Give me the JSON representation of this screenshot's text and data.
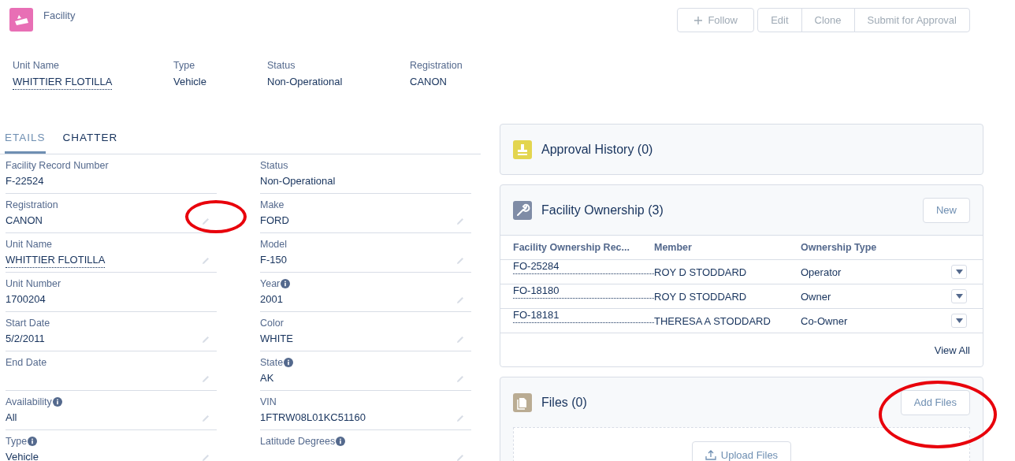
{
  "header": {
    "object_type": "Facility",
    "actions": [
      "Follow",
      "Edit",
      "Clone",
      "Submit for Approval"
    ],
    "highlights": [
      {
        "label": "Unit Name",
        "value": "WHITTIER FLOTILLA",
        "link": true
      },
      {
        "label": "Type",
        "value": "Vehicle",
        "link": false
      },
      {
        "label": "Status",
        "value": "Non-Operational",
        "link": false
      },
      {
        "label": "Registration",
        "value": "CANON",
        "link": false
      }
    ]
  },
  "tabs": [
    {
      "label": "ETAILS",
      "selected": true
    },
    {
      "label": "CHATTER",
      "selected": false
    }
  ],
  "fields": [
    {
      "label": "Facility Record Number",
      "value": "F-22524",
      "info": false,
      "editable": false,
      "link": false,
      "circled": false
    },
    {
      "label": "Status",
      "value": "Non-Operational",
      "info": false,
      "editable": false,
      "link": false,
      "circled": false
    },
    {
      "label": "Registration",
      "value": "CANON",
      "info": false,
      "editable": true,
      "link": false,
      "circled": true
    },
    {
      "label": "Make",
      "value": "FORD",
      "info": false,
      "editable": true,
      "link": false,
      "circled": false
    },
    {
      "label": "Unit Name",
      "value": "WHITTIER FLOTILLA",
      "info": false,
      "editable": true,
      "link": true,
      "circled": false
    },
    {
      "label": "Model",
      "value": "F-150",
      "info": false,
      "editable": true,
      "link": false,
      "circled": false
    },
    {
      "label": "Unit Number",
      "value": "1700204",
      "info": false,
      "editable": false,
      "link": false,
      "circled": false
    },
    {
      "label": "Year",
      "value": "2001",
      "info": true,
      "editable": true,
      "link": false,
      "circled": false
    },
    {
      "label": "Start Date",
      "value": "5/2/2011",
      "info": false,
      "editable": true,
      "link": false,
      "circled": false
    },
    {
      "label": "Color",
      "value": "WHITE",
      "info": false,
      "editable": true,
      "link": false,
      "circled": false
    },
    {
      "label": "End Date",
      "info": false,
      "editable": true,
      "circled": false
    },
    {
      "label": "State",
      "value": "AK",
      "info": true,
      "editable": true,
      "link": false,
      "circled": false
    },
    {
      "label": "Availability",
      "value": "All",
      "info": true,
      "editable": true,
      "link": false,
      "circled": false
    },
    {
      "label": "VIN",
      "value": "1FTRW08L01KC51160",
      "info": false,
      "editable": true,
      "link": false,
      "circled": false
    },
    {
      "label": "Type",
      "value": "Vehicle",
      "info": true,
      "editable": true,
      "link": false,
      "circled": false
    },
    {
      "label": "Latitude Degrees",
      "info": true,
      "editable": true,
      "circled": false
    }
  ],
  "approval_history": {
    "title": "Approval History (0)"
  },
  "ownership": {
    "title": "Facility Ownership (3)",
    "new_button": "New",
    "columns": [
      "Facility Ownership Rec...",
      "Member",
      "Ownership Type"
    ],
    "rows": [
      {
        "id": "FO-25284",
        "member": "ROY D STODDARD",
        "type": "Operator"
      },
      {
        "id": "FO-18180",
        "member": "ROY D STODDARD",
        "type": "Owner"
      },
      {
        "id": "FO-18181",
        "member": "THERESA A STODDARD",
        "type": "Co-Owner"
      }
    ],
    "view_all": "View All"
  },
  "files": {
    "title": "Files (0)",
    "add_button": "Add Files",
    "add_circled": true,
    "upload_button": "Upload Files"
  }
}
